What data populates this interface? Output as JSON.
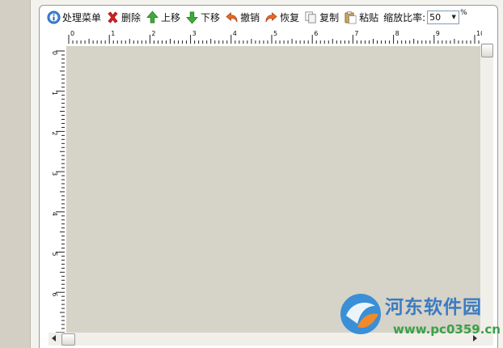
{
  "toolbar": {
    "items": [
      {
        "label": "处理菜单",
        "icon": "info-icon"
      },
      {
        "label": "删除",
        "icon": "delete-x-icon"
      },
      {
        "label": "上移",
        "icon": "arrow-up-icon"
      },
      {
        "label": "下移",
        "icon": "arrow-down-icon"
      },
      {
        "label": "撤销",
        "icon": "undo-icon"
      },
      {
        "label": "恢复",
        "icon": "redo-icon"
      },
      {
        "label": "复制",
        "icon": "copy-icon"
      },
      {
        "label": "粘贴",
        "icon": "paste-icon"
      }
    ],
    "zoom_label": "缩放比率:",
    "zoom_value": "50",
    "zoom_unit": "%"
  },
  "ruler_h": [
    "0",
    "1",
    "2",
    "3",
    "4",
    "5",
    "6",
    "7",
    "8",
    "9",
    "10"
  ],
  "ruler_v": [
    "0",
    "1",
    "2",
    "3",
    "4",
    "5",
    "6",
    "7"
  ],
  "watermark": {
    "brand": "河东软件园",
    "site": "www.pc0359.cn"
  },
  "colors": {
    "canvas": "#d6d3c9",
    "panel_border": "#8f9aa8",
    "brand_blue": "#3a7cc2",
    "brand_green": "#3aa046"
  }
}
